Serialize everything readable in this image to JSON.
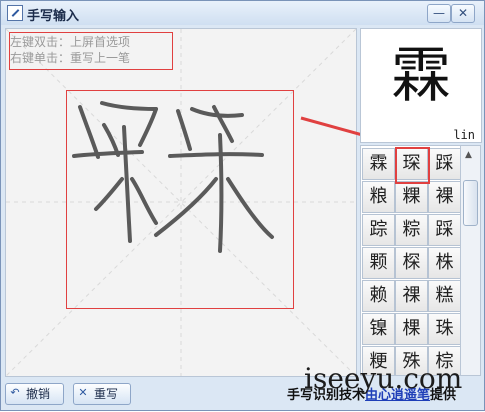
{
  "window": {
    "title": "手写输入",
    "minimize_glyph": "—",
    "close_glyph": "✕"
  },
  "pad": {
    "hint_line1": "左键双击：上屏首选项",
    "hint_line2": "右键单击：重写上一笔"
  },
  "preview": {
    "char": "霖",
    "pinyin": "lin"
  },
  "candidates": [
    [
      "霖",
      "琛",
      "踩"
    ],
    [
      "粮",
      "粿",
      "裸"
    ],
    [
      "踪",
      "粽",
      "踩"
    ],
    [
      "颗",
      "棎",
      "株"
    ],
    [
      "赖",
      "祼",
      "糕"
    ],
    [
      "镍",
      "棵",
      "珠"
    ],
    [
      "粳",
      "殊",
      "棕"
    ]
  ],
  "buttons": {
    "undo": "撤销",
    "rewrite": "重写"
  },
  "credit": {
    "prefix": "手写识别技术",
    "link": "由心逍遥笔",
    "suffix": "提供"
  },
  "watermark": "iseeyu.com",
  "colors": {
    "highlight": "#e04040",
    "link": "#1f3fb8"
  }
}
